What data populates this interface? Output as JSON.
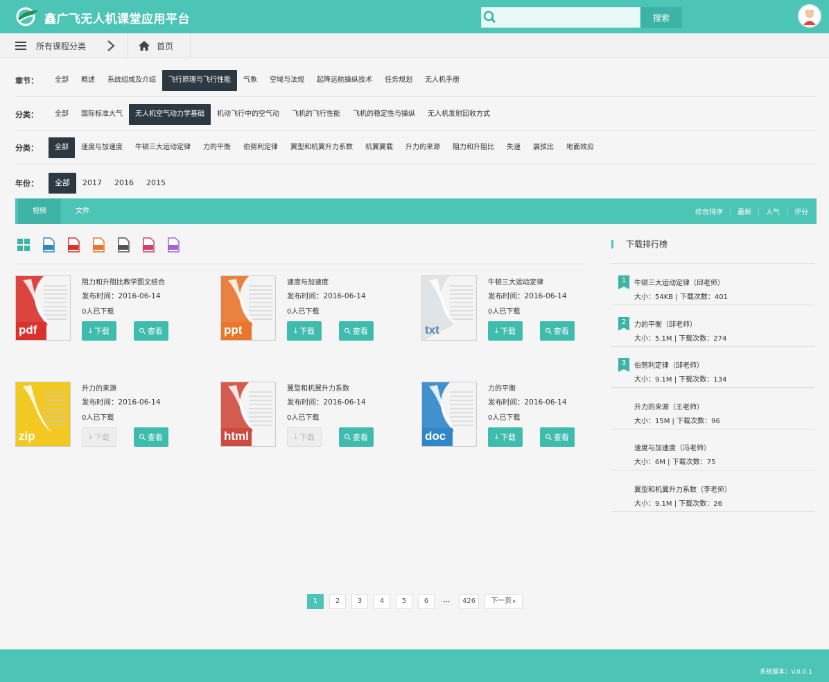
{
  "header": {
    "brand": "鑫广飞无人机课堂应用平台",
    "search_placeholder": "",
    "search_button": "搜索"
  },
  "breadcrumb": {
    "menu_label": "所有课程分类",
    "home_label": "首页"
  },
  "filters": {
    "chapter": {
      "label": "章节：",
      "items": [
        "全部",
        "概述",
        "系统组成及介绍",
        "飞行原理与飞行性能",
        "气象",
        "空域与法规",
        "起降运航操纵技术",
        "任务规划",
        "无人机手册"
      ],
      "active": 3
    },
    "category1": {
      "label": "分类：",
      "items": [
        "全部",
        "国际标准大气",
        "无人机空气动力学基础",
        "机动飞行中的空气动",
        "飞机的飞行性能",
        "飞机的稳定性与操纵",
        "无人机发射回收方式"
      ],
      "active": 2
    },
    "category2": {
      "label": "分类：",
      "items": [
        "全部",
        "速度与加速度",
        "牛顿三大运动定律",
        "力的平衡",
        "伯努利定律",
        "翼型和机翼升力系数",
        "机翼翼载",
        "升力的来源",
        "阻力和升阻比",
        "失速",
        "展弦比",
        "地面效应"
      ],
      "active": 0
    },
    "year": {
      "label": "年份：",
      "items": [
        "全部",
        "2017",
        "2016",
        "2015"
      ],
      "active": 0
    }
  },
  "tabs": {
    "video": "视频",
    "file": "文件",
    "sort": [
      "综合排序",
      "最新",
      "人气",
      "评分"
    ]
  },
  "format_icons": [
    "grid-icon",
    "doc-icon",
    "pdf-icon",
    "ppt-icon",
    "txt-icon",
    "html-icon",
    "zip-icon"
  ],
  "files": [
    {
      "title": "阻力和升阻比教学图文结合",
      "date": "发布时间：2016-06-14",
      "count": "0人已下载",
      "type": "pdf",
      "color": "#d9312b",
      "download": "下载",
      "view": "查看",
      "enabled": true
    },
    {
      "title": "速度与加速度",
      "date": "发布时间：2016-06-14",
      "count": "0人已下载",
      "type": "ppt",
      "color": "#e8762d",
      "download": "下载",
      "view": "查看",
      "enabled": true
    },
    {
      "title": "牛顿三大运动定律",
      "date": "发布时间：2016-06-14",
      "count": "0人已下载",
      "type": "txt",
      "color": "#7a8a99",
      "download": "下载",
      "view": "查看",
      "enabled": true
    },
    {
      "title": "升力的来源",
      "date": "发布时间：2016-06-14",
      "count": "0人已下载",
      "type": "zip",
      "color": "#f2c923",
      "download": "下载",
      "view": "查看",
      "enabled": false
    },
    {
      "title": "翼型和机翼升力系数",
      "date": "发布时间：2016-06-14",
      "count": "0人已下载",
      "type": "html",
      "color": "#cf4a3e",
      "download": "下载",
      "view": "查看",
      "enabled": false
    },
    {
      "title": "力的平衡",
      "date": "发布时间：2016-06-14",
      "count": "0人已下载",
      "type": "doc",
      "color": "#2f86c9",
      "download": "下载",
      "view": "查看",
      "enabled": true
    }
  ],
  "ranking": {
    "title": "下载排行榜",
    "items": [
      {
        "rank": "1",
        "name": "牛顿三大运动定律（邱老师）",
        "meta": "大小：54KB  |  下载次数：401"
      },
      {
        "rank": "2",
        "name": "力的平衡（邱老师）",
        "meta": "大小：5.1M  |  下载次数：274"
      },
      {
        "rank": "3",
        "name": "伯努利定律（邱老师）",
        "meta": "大小：9.1M  |  下载次数：134"
      },
      {
        "rank": "",
        "name": "升力的来源（王老师）",
        "meta": "大小：15M  |  下载次数：96"
      },
      {
        "rank": "",
        "name": "速度与加速度（冯老师）",
        "meta": "大小：6M  |  下载次数：75"
      },
      {
        "rank": "",
        "name": "翼型和机翼升力系数（李老师）",
        "meta": "大小：9.1M  |  下载次数：26"
      }
    ]
  },
  "pager": {
    "pages": [
      "1",
      "2",
      "3",
      "4",
      "5",
      "6"
    ],
    "dots": "…",
    "last": "426",
    "next": "下一页"
  },
  "footer": {
    "version": "系统版本：V.0.0.1"
  }
}
